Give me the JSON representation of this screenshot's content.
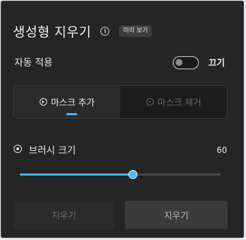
{
  "header": {
    "title": "생성형 지우기",
    "preview_badge": "미리 보기"
  },
  "auto_apply": {
    "label": "자동 적용",
    "state_label": "끄기",
    "enabled": false
  },
  "mask_tabs": {
    "add_label": "마스크 추가",
    "remove_label": "마스크 제거",
    "selected": "add"
  },
  "brush": {
    "label": "브러시 크기",
    "value": "60",
    "fraction": 0.56
  },
  "buttons": {
    "secondary_label": "지우기",
    "primary_label": "지우기"
  },
  "colors": {
    "accent": "#4fb6f5",
    "panel_bg": "#252525"
  }
}
